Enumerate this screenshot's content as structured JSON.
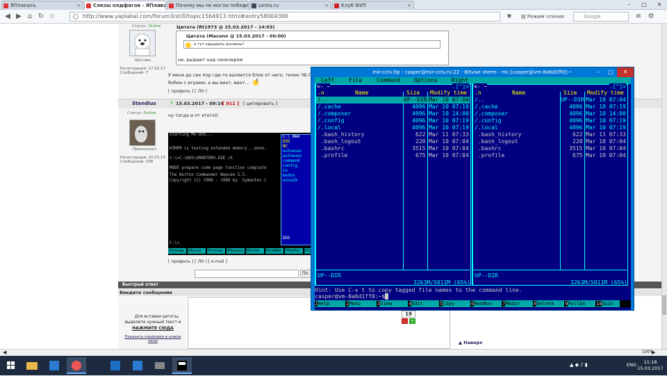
{
  "browser": {
    "tabs": [
      {
        "label": "ЯПлакалъ",
        "active": false
      },
      {
        "label": "Слезы олдфагов - ЯПлакалъ",
        "active": true
      },
      {
        "label": "Почему мы не могли победи...",
        "active": false
      },
      {
        "label": "Lenta.ru",
        "active": false
      },
      {
        "label": "Клуб ФУП",
        "active": false
      }
    ],
    "url": "http://www.yaplakal.com/forum3/st/0/topic1564913.html#entry58004300",
    "reader_mode": "Режим чтения",
    "search_placeholder": "Google",
    "zoom": "100%"
  },
  "post1": {
    "status_label": "Статус:",
    "status_value": "Online",
    "user_rank": "Шутник",
    "reg_label": "Регистрация: 17.02.17",
    "msgs_label": "Сообщений: 7",
    "quote_outer_header": "Цитата (Rt1973 @ 15.03.2017 - 14:03)",
    "quote_inner_header": "Цитата (Maconn @ 15.03.2017 - 00:00)",
    "quote_inner_text": "а тут зарыдать должны?",
    "quote_outer_text": "не, рыдают над синклером",
    "body_line1": "У меня до сих пор где-то валяется блок от него, телик ЧБ П...",
    "body_line2": "бобин с играми, а вы винт, винт...",
    "links": "[ профиль ] [ ЛН ]"
  },
  "post2": {
    "author": "Stendius",
    "date": "15.03.2017 - 09:16",
    "post_num": "[ 911 ]",
    "quote_btn": "[ цитировать ]",
    "status_label": "Статус:",
    "status_value": "Online",
    "user_rank": "Прикольнут",
    "reg_label": "Регистрация: 10.03.15",
    "msgs_label": "Сообщений: 336",
    "body": "ну тогда и от этого))",
    "links": "[ профиль ] [ ЛН ] [ e-mail ]",
    "dos_lines": [
      "Starting MS-DOS...",
      "",
      "HIMEM is testing extended memory...done.",
      "",
      "C:\\>C:\\DOS\\SMARTDRV.EXE /X",
      "",
      "MODE prepare code page function complete",
      "The Norton Commander Версия 5.5.",
      "Copyright (C) 1986 - 1998 by  Symantec C",
      "",
      "",
      "",
      "",
      "",
      "",
      "",
      "C:\\>_"
    ],
    "dos_panel_items": [
      "C:\\ Имя",
      "DOS",
      "NC",
      "autoexec",
      "autoexec",
      "command",
      "config",
      "io",
      "msdos",
      "wina20",
      "DOS"
    ],
    "dos_keys": [
      "1Помощь",
      "2Вызов",
      "3Чтение",
      "4Правка",
      "5Копия",
      "6НовИмя",
      "7НовКат",
      "8Удал"
    ]
  },
  "reply": {
    "header": "Быстрый ответ",
    "entry_label": "Введите сообщение",
    "hint1": "Для вставки цитаты,",
    "hint2": "выделите нужный текст и",
    "hint3": "НАЖМИТЕ СЮДА",
    "smileys_link": "Показать смайлики в новом окне",
    "counter": "19",
    "back_top": "Наверх"
  },
  "terminal": {
    "title": "mir-cctv.tlp - casper@mir-cctv.ru:22 - Bitvise xterm - mc [casper@vm-8a6d1ff0]:~",
    "menu": [
      "Left",
      "File",
      "Command",
      "Options",
      "Right"
    ],
    "left_panel": {
      "path": "<- ~",
      "nav": ".[^]>",
      "cols": {
        "n": ".n",
        "name": "Name",
        "size": "Size",
        "mtime": "Modify time"
      },
      "files": [
        {
          "name": "/..",
          "size": "UP--DIR",
          "mtime": "Mar 10 07:04",
          "selected": true
        },
        {
          "name": "/.cache",
          "size": "4096",
          "mtime": "Mar 10 07:19",
          "selected": false
        },
        {
          "name": "/.composer",
          "size": "4096",
          "mtime": "Mar 10 14:00",
          "selected": false
        },
        {
          "name": "/.config",
          "size": "4096",
          "mtime": "Mar 10 07:19",
          "selected": false
        },
        {
          "name": "/.local",
          "size": "4096",
          "mtime": "Mar 10 07:19",
          "selected": false
        },
        {
          "name": " .bash_history",
          "size": "622",
          "mtime": "Mar 11 07:33",
          "selected": false
        },
        {
          "name": " .bash_logout",
          "size": "220",
          "mtime": "Mar 10 07:04",
          "selected": false
        },
        {
          "name": " .bashrc",
          "size": "3515",
          "mtime": "Mar 10 07:04",
          "selected": false
        },
        {
          "name": " .profile",
          "size": "675",
          "mtime": "Mar 10 07:04",
          "selected": false
        }
      ],
      "status": "UP--DIR",
      "disk": "3263M/5011M (65%)"
    },
    "right_panel": {
      "path": "<- ~",
      "nav": ".[^]>",
      "cols": {
        "n": ".n",
        "name": "Name",
        "size": "Size",
        "mtime": "Modify time"
      },
      "files": [
        {
          "name": "/..",
          "size": "UP--DIR",
          "mtime": "Mar 10 07:04"
        },
        {
          "name": "/.cache",
          "size": "4096",
          "mtime": "Mar 10 07:19"
        },
        {
          "name": "/.composer",
          "size": "4096",
          "mtime": "Mar 10 14:00"
        },
        {
          "name": "/.config",
          "size": "4096",
          "mtime": "Mar 10 07:19"
        },
        {
          "name": "/.local",
          "size": "4096",
          "mtime": "Mar 10 07:19"
        },
        {
          "name": " .bash_history",
          "size": "622",
          "mtime": "Mar 11 07:33"
        },
        {
          "name": " .bash_logout",
          "size": "220",
          "mtime": "Mar 10 07:04"
        },
        {
          "name": " .bashrc",
          "size": "3515",
          "mtime": "Mar 10 07:04"
        },
        {
          "name": " .profile",
          "size": "675",
          "mtime": "Mar 10 07:04"
        }
      ],
      "status": "UP--DIR",
      "disk": "3263M/5011M (65%)"
    },
    "hint": "Hint: Use C-x t to copy tagged file names to the command line.",
    "prompt": "casper@vm-8a6d1ff0:~$",
    "fkeys": [
      {
        "n": "1",
        "label": "Help"
      },
      {
        "n": "2",
        "label": "Menu"
      },
      {
        "n": "3",
        "label": "View"
      },
      {
        "n": "4",
        "label": "Edit"
      },
      {
        "n": "5",
        "label": "Copy"
      },
      {
        "n": "6",
        "label": "RenMov"
      },
      {
        "n": "7",
        "label": "Mkdir"
      },
      {
        "n": "8",
        "label": "Delete"
      },
      {
        "n": "9",
        "label": "PullDn"
      },
      {
        "n": "10",
        "label": "Quit"
      }
    ]
  },
  "taskbar": {
    "lang": "ENG",
    "time": "11:18",
    "date": "15.03.2017"
  }
}
